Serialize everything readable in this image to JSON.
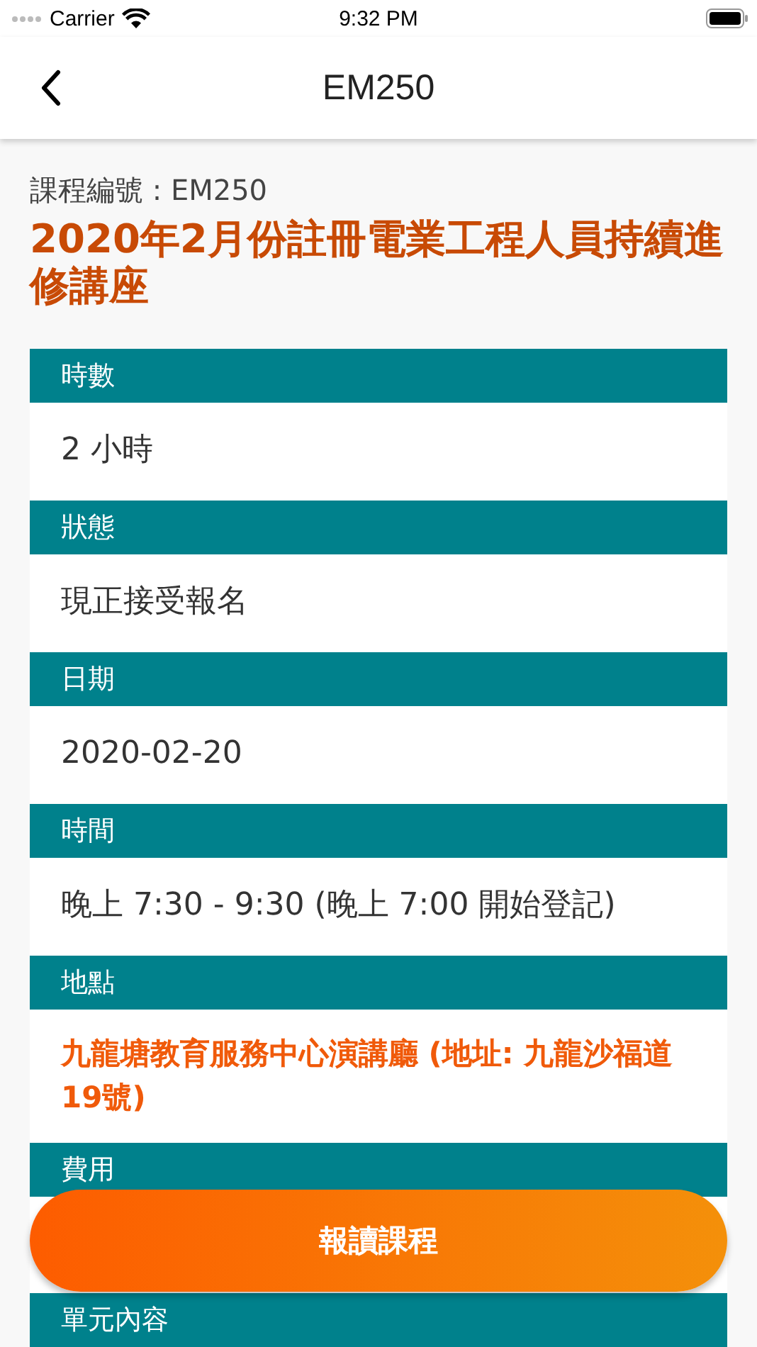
{
  "status_bar": {
    "carrier": "Carrier",
    "time": "9:32 PM"
  },
  "nav": {
    "title": "EM250"
  },
  "course": {
    "code_label": "課程編號 : EM250",
    "title": "2020年2月份註冊電業工程人員持續進修講座"
  },
  "sections": [
    {
      "label": "時數",
      "value": "2 小時",
      "kind": "text"
    },
    {
      "label": "狀態",
      "value": "現正接受報名",
      "kind": "text"
    },
    {
      "label": "日期",
      "value": "2020-02-20",
      "kind": "text"
    },
    {
      "label": "時間",
      "value": "晚上 7:30 - 9:30 (晚上 7:00 開始登記)",
      "kind": "text"
    },
    {
      "label": "地點",
      "value": "九龍塘教育服務中心演講廳 (地址: 九龍沙福道19號)",
      "kind": "highlight"
    },
    {
      "label": "費用",
      "kind": "hidden"
    },
    {
      "label": "單元內容",
      "kind": "hidden"
    }
  ],
  "enroll_button": "報讀課程"
}
